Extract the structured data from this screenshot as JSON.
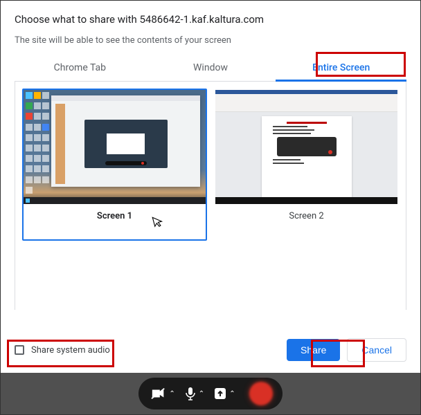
{
  "dialog": {
    "title": "Choose what to share with 5486642-1.kaf.kaltura.com",
    "subtitle": "The site will be able to see the contents of your screen"
  },
  "tabs": {
    "chrome_tab": "Chrome Tab",
    "window": "Window",
    "entire_screen": "Entire Screen"
  },
  "screens": [
    {
      "label": "Screen 1",
      "selected": true
    },
    {
      "label": "Screen 2",
      "selected": false
    }
  ],
  "footer": {
    "audio_label": "Share system audio",
    "share_label": "Share",
    "cancel_label": "Cancel"
  },
  "highlights": {
    "entire_screen_tab": true,
    "share_button": true,
    "audio_checkbox": true
  }
}
